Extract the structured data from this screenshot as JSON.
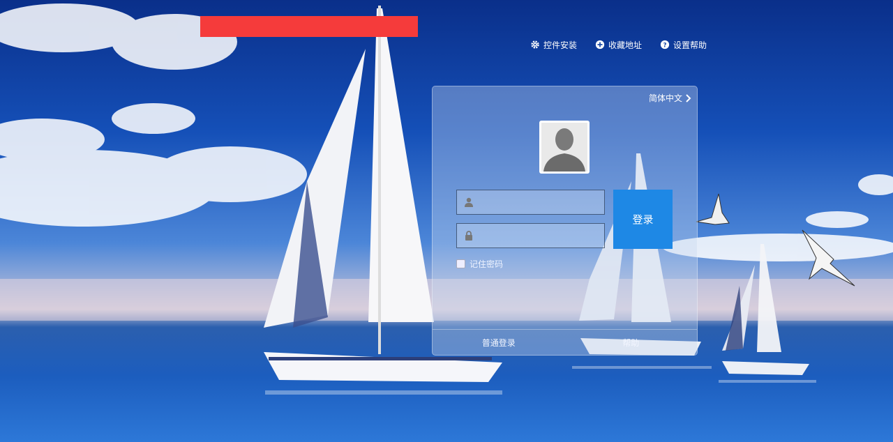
{
  "header": {
    "links": [
      {
        "label": "控件安装",
        "icon": "gear-icon"
      },
      {
        "label": "收藏地址",
        "icon": "plus-circle-icon"
      },
      {
        "label": "设置帮助",
        "icon": "question-circle-icon"
      }
    ]
  },
  "login": {
    "language": "简体中文",
    "username": {
      "value": "",
      "placeholder": ""
    },
    "password": {
      "value": "",
      "placeholder": ""
    },
    "login_label": "登录",
    "remember_label": "记住密码",
    "quick_login_label": "普通登录",
    "help_label": "帮助"
  },
  "colors": {
    "accent": "#1e88e5",
    "redacted_bar": "#f53b3b"
  }
}
